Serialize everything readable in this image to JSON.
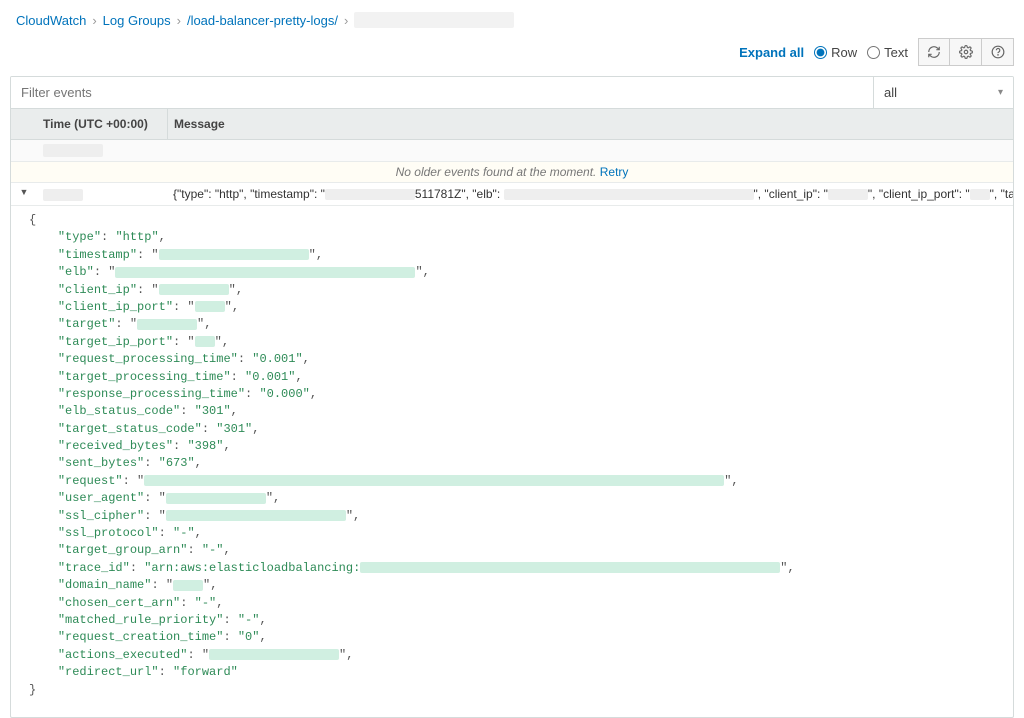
{
  "breadcrumbs": {
    "a": "CloudWatch",
    "b": "Log Groups",
    "c": "/load-balancer-pretty-logs/"
  },
  "toolbar": {
    "expand_all": "Expand all",
    "row_label": "Row",
    "text_label": "Text"
  },
  "filter": {
    "placeholder": "Filter events",
    "scope": "all"
  },
  "headers": {
    "time": "Time (UTC +00:00)",
    "message": "Message"
  },
  "older_banner": {
    "text": "No older events found at the moment.",
    "retry": "Retry"
  },
  "event": {
    "preview_pre": "{\"type\": \"http\", \"timestamp\": \"",
    "preview_mid": "511781Z\", \"elb\":",
    "preview_post1": "\", \"client_ip\": \"",
    "preview_post2": "\", \"client_ip_port\": \"",
    "preview_post3": "\", \"targ"
  },
  "json_fields": {
    "type_key": "\"type\"",
    "type_val": "\"http\"",
    "timestamp_key": "\"timestamp\"",
    "elb_key": "\"elb\"",
    "client_ip_key": "\"client_ip\"",
    "client_ip_port_key": "\"client_ip_port\"",
    "target_key": "\"target\"",
    "target_ip_port_key": "\"target_ip_port\"",
    "rpt_key": "\"request_processing_time\"",
    "rpt_val": "\"0.001\"",
    "tpt_key": "\"target_processing_time\"",
    "tpt_val": "\"0.001\"",
    "respt_key": "\"response_processing_time\"",
    "respt_val": "\"0.000\"",
    "elb_sc_key": "\"elb_status_code\"",
    "elb_sc_val": "\"301\"",
    "tgt_sc_key": "\"target_status_code\"",
    "tgt_sc_val": "\"301\"",
    "rcv_key": "\"received_bytes\"",
    "rcv_val": "\"398\"",
    "snt_key": "\"sent_bytes\"",
    "snt_val": "\"673\"",
    "req_key": "\"request\"",
    "ua_key": "\"user_agent\"",
    "sslc_key": "\"ssl_cipher\"",
    "sslp_key": "\"ssl_protocol\"",
    "dash_val": "\"-\"",
    "tga_key": "\"target_group_arn\"",
    "tid_key": "\"trace_id\"",
    "tid_prefix": "\"arn:aws:elasticloadbalancing:",
    "dom_key": "\"domain_name\"",
    "cca_key": "\"chosen_cert_arn\"",
    "mrp_key": "\"matched_rule_priority\"",
    "rct_key": "\"request_creation_time\"",
    "rct_val": "\"0\"",
    "ae_key": "\"actions_executed\"",
    "ru_key": "\"redirect_url\"",
    "ru_val": "\"forward\""
  },
  "braces": {
    "open": "{",
    "close": "}"
  }
}
